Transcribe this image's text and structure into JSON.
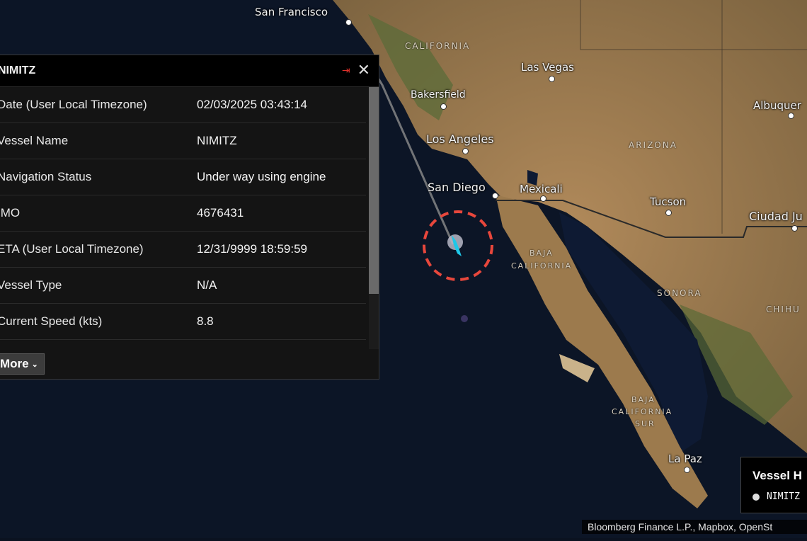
{
  "map": {
    "cities": [
      {
        "id": "sf",
        "name": "San Francisco"
      },
      {
        "id": "bak",
        "name": "Bakersfield"
      },
      {
        "id": "lv",
        "name": "Las Vegas"
      },
      {
        "id": "la",
        "name": "Los Angeles"
      },
      {
        "id": "sd",
        "name": "San Diego"
      },
      {
        "id": "mex",
        "name": "Mexicali"
      },
      {
        "id": "tuc",
        "name": "Tucson"
      },
      {
        "id": "alb",
        "name": "Albuquer"
      },
      {
        "id": "cj",
        "name": "Ciudad Ju"
      },
      {
        "id": "lp",
        "name": "La Paz"
      }
    ],
    "regions": [
      "CALIFORNIA",
      "ARIZONA",
      "BAJA",
      "CALIFORNIA",
      "SONORA",
      "CHIHU",
      "BAJA",
      "CALIFORNIA",
      "SUR"
    ]
  },
  "panel": {
    "title": "NIMITZ",
    "pin_icon": "pin-icon",
    "close_icon": "close-icon",
    "rows": [
      {
        "label": "Date (User Local Timezone)",
        "value": "02/03/2025 03:43:14"
      },
      {
        "label": "Vessel Name",
        "value": "NIMITZ"
      },
      {
        "label": "Navigation Status",
        "value": "Under way using engine"
      },
      {
        "label": "IMO",
        "value": "4676431"
      },
      {
        "label": "ETA (User Local Timezone)",
        "value": "12/31/9999 18:59:59"
      },
      {
        "label": "Vessel Type",
        "value": "N/A"
      },
      {
        "label": "Current Speed (kts)",
        "value": "8.8"
      }
    ],
    "more_label": "More"
  },
  "legend": {
    "title": "Vessel H",
    "item": "NIMITZ"
  },
  "attribution": "Bloomberg Finance L.P., Mapbox, OpenSt",
  "colors": {
    "highlight_circle": "#e8473c",
    "vessel_marker": "#1ec8e8",
    "pin": "#e0302a"
  }
}
